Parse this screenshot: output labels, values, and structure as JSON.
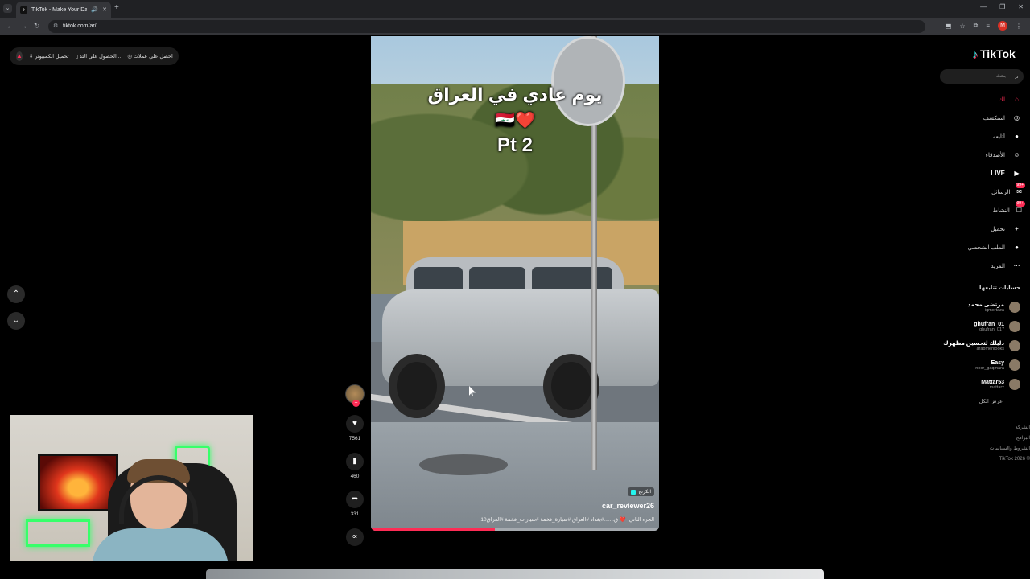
{
  "browser": {
    "tab_title": "TikTok - Make Your Day",
    "url": "tiktok.com/ar/",
    "profile_initial": "M"
  },
  "promo": {
    "item1": "تحميل الكمبيوتر",
    "item2": "الحصول على التد...",
    "item3": "احصل على عملات"
  },
  "video": {
    "overlay_line1": "يوم عادي في العراق",
    "overlay_line2": "🇮🇶❤️",
    "overlay_line3": "Pt 2",
    "badge": "الكرنج",
    "author": "car_reviewer26",
    "caption": "الجزء الثاني: ❤️ ق.......#بغداد #العراق #سيارة_فخمة #سيارات_فخمة #العراق10",
    "progress": 0.43
  },
  "actions": {
    "likes": "7561",
    "saves": "460",
    "shares": "331"
  },
  "sidebar": {
    "logo_text": "TikTok",
    "search_placeholder": "بحث",
    "nav": [
      {
        "label": "لك",
        "icon": "home-icon",
        "glyph": "⌂"
      },
      {
        "label": "استكشف",
        "icon": "compass-icon",
        "glyph": "◎"
      },
      {
        "label": "أتابعه",
        "icon": "following-icon",
        "glyph": "●"
      },
      {
        "label": "الأصدقاء",
        "icon": "friends-icon",
        "glyph": "☺"
      },
      {
        "label": "LIVE",
        "icon": "live-icon",
        "glyph": "▶"
      },
      {
        "label": "الرسائل",
        "icon": "messages-icon",
        "glyph": "✉",
        "badge": "99+"
      },
      {
        "label": "النشاط",
        "icon": "activity-icon",
        "glyph": "☐",
        "badge": "99+"
      },
      {
        "label": "تحميل",
        "icon": "upload-icon",
        "glyph": "+"
      },
      {
        "label": "الملف الشخصي",
        "icon": "profile-icon",
        "glyph": "●"
      },
      {
        "label": "المزيد",
        "icon": "more-icon",
        "glyph": "⋯"
      }
    ],
    "following_title": "حسابات تتابعها",
    "accounts": [
      {
        "name": "مرتضى محمد",
        "handle": "iqmortaza"
      },
      {
        "name": "ghufran_01",
        "handle": "ghufran_017"
      },
      {
        "name": "دليلك لتحسين مظهرك",
        "handle": "arabmenlooks"
      },
      {
        "name": "Easy",
        "handle": "noor_gaqmara"
      },
      {
        "name": "Mattar53",
        "handle": "mattarx"
      }
    ],
    "see_all": "عرض الكل",
    "footer": [
      "الشركة",
      "البرامج",
      "الشروط والسياسات",
      "TikTok 2026 ©"
    ]
  },
  "colors": {
    "accent": "#fe2c55",
    "cyan": "#25f4ee"
  }
}
